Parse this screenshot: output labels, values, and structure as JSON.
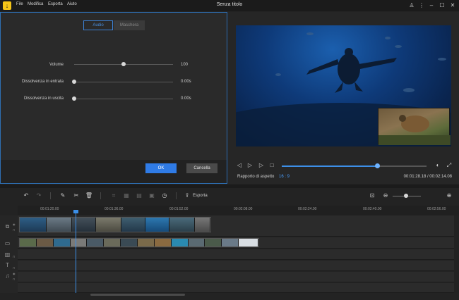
{
  "app": {
    "title": "Senza titolo",
    "menu": [
      "File",
      "Modifica",
      "Esporta",
      "Aiuto"
    ]
  },
  "panel": {
    "tabs": [
      "Audio",
      "Maschera"
    ],
    "active_tab": "Audio",
    "params": [
      {
        "label": "Volume",
        "value": "100",
        "level": 0.5
      },
      {
        "label": "Dissolvenza in entrata",
        "value": "0.00s",
        "level": 0
      },
      {
        "label": "Dissolvenza in uscita",
        "value": "0.00s",
        "level": 0
      }
    ],
    "ok_label": "OK",
    "cancel_label": "Cancella"
  },
  "preview": {
    "aspect_label": "Rapporto di aspetto",
    "aspect_value": "16 : 9",
    "timecode": "00:01:28.18 / 00:02:14.08",
    "progress": 0.66
  },
  "toolbar": {
    "export_label": "Esporta"
  },
  "timeline": {
    "ruler_ticks": [
      "00:01:20.00",
      "00:01:36.00",
      "00:01:52.00",
      "00:02:08.00",
      "00:02:24.00",
      "00:02:40.00",
      "00:02:56.00"
    ]
  },
  "colors": {
    "accent": "#2f7be6",
    "playhead": "#3b8fe8"
  }
}
